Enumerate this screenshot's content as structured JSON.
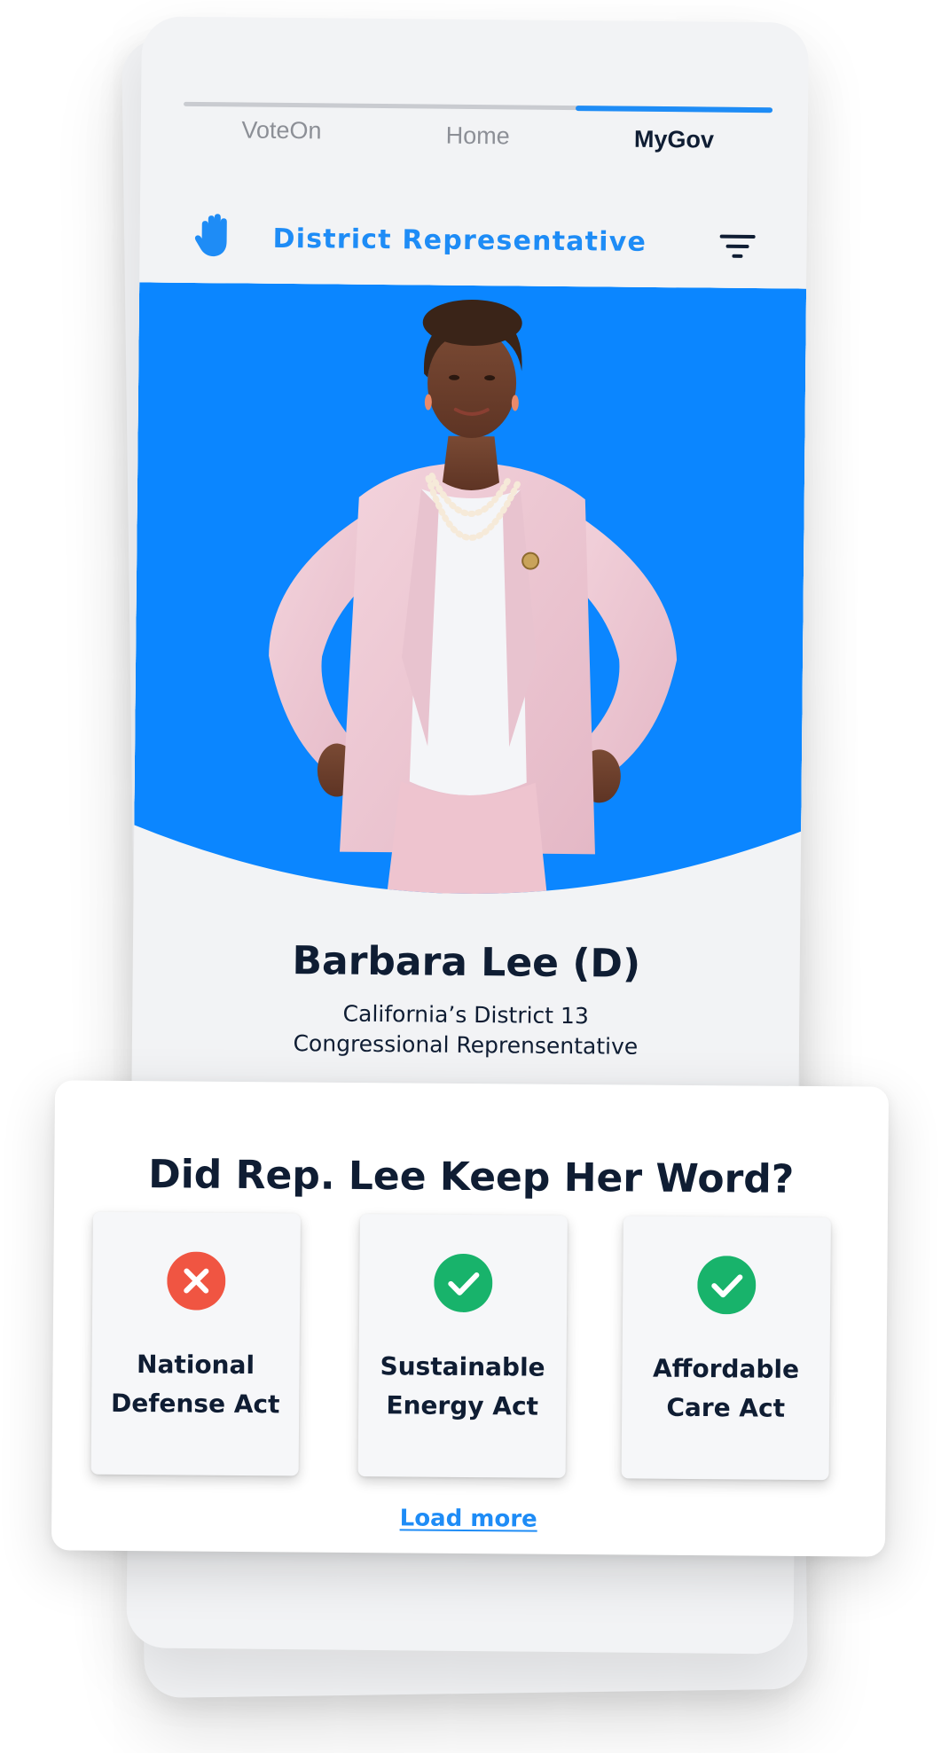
{
  "tabs": [
    {
      "label": "VoteOn",
      "active": false
    },
    {
      "label": "Home",
      "active": false
    },
    {
      "label": "MyGov",
      "active": true
    }
  ],
  "header": {
    "title": "District Representative",
    "left_icon": "raised-hand-icon",
    "right_icon": "filter-icon"
  },
  "representative": {
    "name": "Barbara Lee (D)",
    "district": "California’s District 13",
    "role": "Congressional Reprensentative",
    "photo": "representative-portrait"
  },
  "keep_word": {
    "title": "Did Rep. Lee Keep Her Word?",
    "bills": [
      {
        "line1": "National",
        "line2": "Defense Act",
        "status": "broken",
        "icon": "x-circle-icon",
        "color": "#f05542"
      },
      {
        "line1": "Sustainable",
        "line2": "Energy Act",
        "status": "kept",
        "icon": "check-circle-icon",
        "color": "#18b36b"
      },
      {
        "line1": "Affordable",
        "line2": "Care Act",
        "status": "kept",
        "icon": "check-circle-icon",
        "color": "#18b36b"
      }
    ],
    "load_more": "Load more"
  },
  "colors": {
    "accent": "#1e8cf6",
    "text_dark": "#0f1d33",
    "background": "#f2f3f5",
    "hero_blue": "#0b86ff"
  }
}
